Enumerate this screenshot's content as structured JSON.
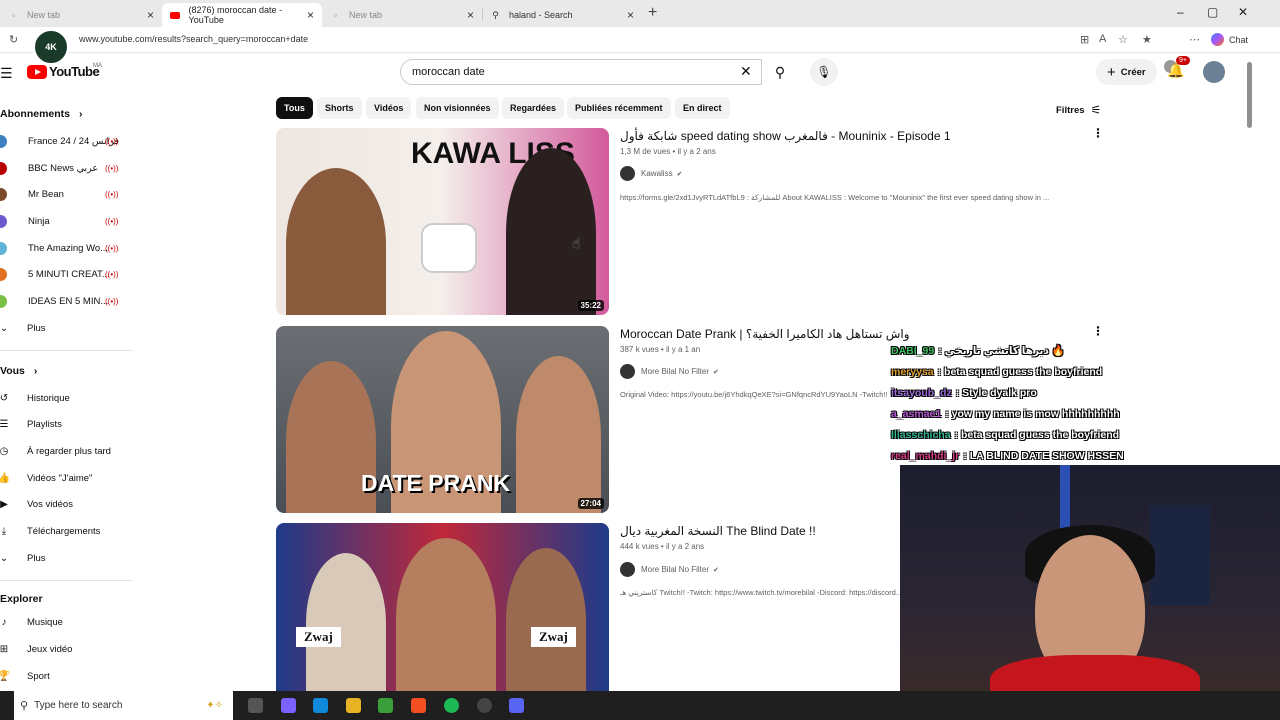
{
  "browser": {
    "tabs": [
      {
        "label": "New tab",
        "active": false
      },
      {
        "label": "(8276) moroccan date - YouTube",
        "active": true
      },
      {
        "label": "New tab",
        "active": false
      },
      {
        "label": "haland - Search",
        "active": false
      }
    ],
    "url": "www.youtube.com/results?search_query=moroccan+date",
    "chat_label": "Chat"
  },
  "header": {
    "logo": "YouTube",
    "country": "MA",
    "search_value": "moroccan date",
    "create_label": "Créer",
    "notif_count": "9+"
  },
  "channel_logo_text": "4K",
  "sidebar": {
    "subs_title": "Abonnements",
    "subs": [
      {
        "label": "France 24 / فرانس 24",
        "color": "#3e7fc1"
      },
      {
        "label": "BBC News عربي",
        "color": "#b80000"
      },
      {
        "label": "Mr Bean",
        "color": "#7a4a2a"
      },
      {
        "label": "Ninja",
        "color": "#6a5acd"
      },
      {
        "label": "The Amazing Wo...",
        "color": "#5fb3d9"
      },
      {
        "label": "5 MINUTI CREAT...",
        "color": "#e07020"
      },
      {
        "label": "IDEAS EN 5 MIN...",
        "color": "#7ac143"
      }
    ],
    "subs_more": "Plus",
    "you_title": "Vous",
    "you": [
      {
        "label": "Historique",
        "icon": "↺"
      },
      {
        "label": "Playlists",
        "icon": "☰"
      },
      {
        "label": "À regarder plus tard",
        "icon": "◷"
      },
      {
        "label": "Vidéos \"J'aime\"",
        "icon": "👍"
      },
      {
        "label": "Vos vidéos",
        "icon": "▶"
      },
      {
        "label": "Téléchargements",
        "icon": "⤓"
      },
      {
        "label": "Plus",
        "icon": "⌄"
      }
    ],
    "explore_title": "Explorer",
    "explore": [
      {
        "label": "Musique",
        "icon": "♪"
      },
      {
        "label": "Jeux vidéo",
        "icon": "⊞"
      },
      {
        "label": "Sport",
        "icon": "🏆"
      }
    ]
  },
  "chips": [
    "Tous",
    "Shorts",
    "Vidéos",
    "Non visionnées",
    "Regardées",
    "Publiées récemment",
    "En direct"
  ],
  "filters_label": "Filtres",
  "results": [
    {
      "title": "شابكة فأول speed dating show فالمغرب - Mouninix - Episode 1",
      "meta": "1,3 M de vues • il y a 2 ans",
      "channel": "Kawaliss",
      "desc": "https://forms.gle/2xd1JvyRTLdATfbL9 : للمشاركة About KAWALISS : Welcome to \"Mouninix\" the first ever speed dating show in ...",
      "duration": "35:22",
      "thumb_text": "KAWA LISS",
      "thumb_bg": "#e9e2dc"
    },
    {
      "title": "Moroccan Date Prank | واش تستاهل هاد الكاميرا الخفية؟",
      "meta": "387 k vues • il y a 1 an",
      "channel": "More Bilal No Filter",
      "desc": "Original Video: https://youtu.be/j6YhdkqQeXE?si=GNfqncRdYU9YaoLN -Twitch!! -Twitch: https://www.twitch.tv/morebilal -Discord: ...",
      "duration": "27:04",
      "thumb_text": "DATE PRANK",
      "thumb_bg": "#5a5f66"
    },
    {
      "title": "النسخة المغربية ديال The Blind Date !!",
      "meta": "444 k vues • il y a 2 ans",
      "channel": "More Bilal No Filter",
      "desc": "كاستريني هـ Twitch!! -Twitch: https://www.twitch.tv/morebilal -Discord: https://discord...",
      "duration": "",
      "thumb_text": "Zwaj",
      "thumb_bg": "#b3222b"
    }
  ],
  "chat": [
    {
      "user": "DABI_99",
      "user_color": "#3fbf5f",
      "msg": ": دبرها كاتشي تاريخي 🔥"
    },
    {
      "user": "meryysa",
      "user_color": "#e0a030",
      "msg": ": beta squad guess the boyfriend"
    },
    {
      "user": "itsayoub_dz",
      "user_color": "#9a6ad6",
      "msg": ": Style dyalk pro"
    },
    {
      "user": "a_asmae1",
      "user_color": "#b657d6",
      "msg": ": yow my name is mow hhhhhhhhh"
    },
    {
      "user": "Iliasschicha",
      "user_color": "#2fb58f",
      "msg": ": beta squad guess the boyfriend"
    },
    {
      "user": "real_mahdi_jr",
      "user_color": "#d83a8a",
      "msg": ": LA BLIND DATE SHOW HSSEN"
    }
  ],
  "taskbar": {
    "search_placeholder": "Type here to search",
    "apps": [
      {
        "name": "task-view",
        "color": "#555"
      },
      {
        "name": "copilot",
        "color": "#7b61ff"
      },
      {
        "name": "edge",
        "color": "#0f8ad8"
      },
      {
        "name": "file-explorer",
        "color": "#e6b422"
      },
      {
        "name": "store",
        "color": "#3a9e3a"
      },
      {
        "name": "brave",
        "color": "#f25022"
      },
      {
        "name": "spotify",
        "color": "#1db954"
      },
      {
        "name": "obs",
        "color": "#444"
      },
      {
        "name": "discord",
        "color": "#5865f2"
      }
    ]
  }
}
